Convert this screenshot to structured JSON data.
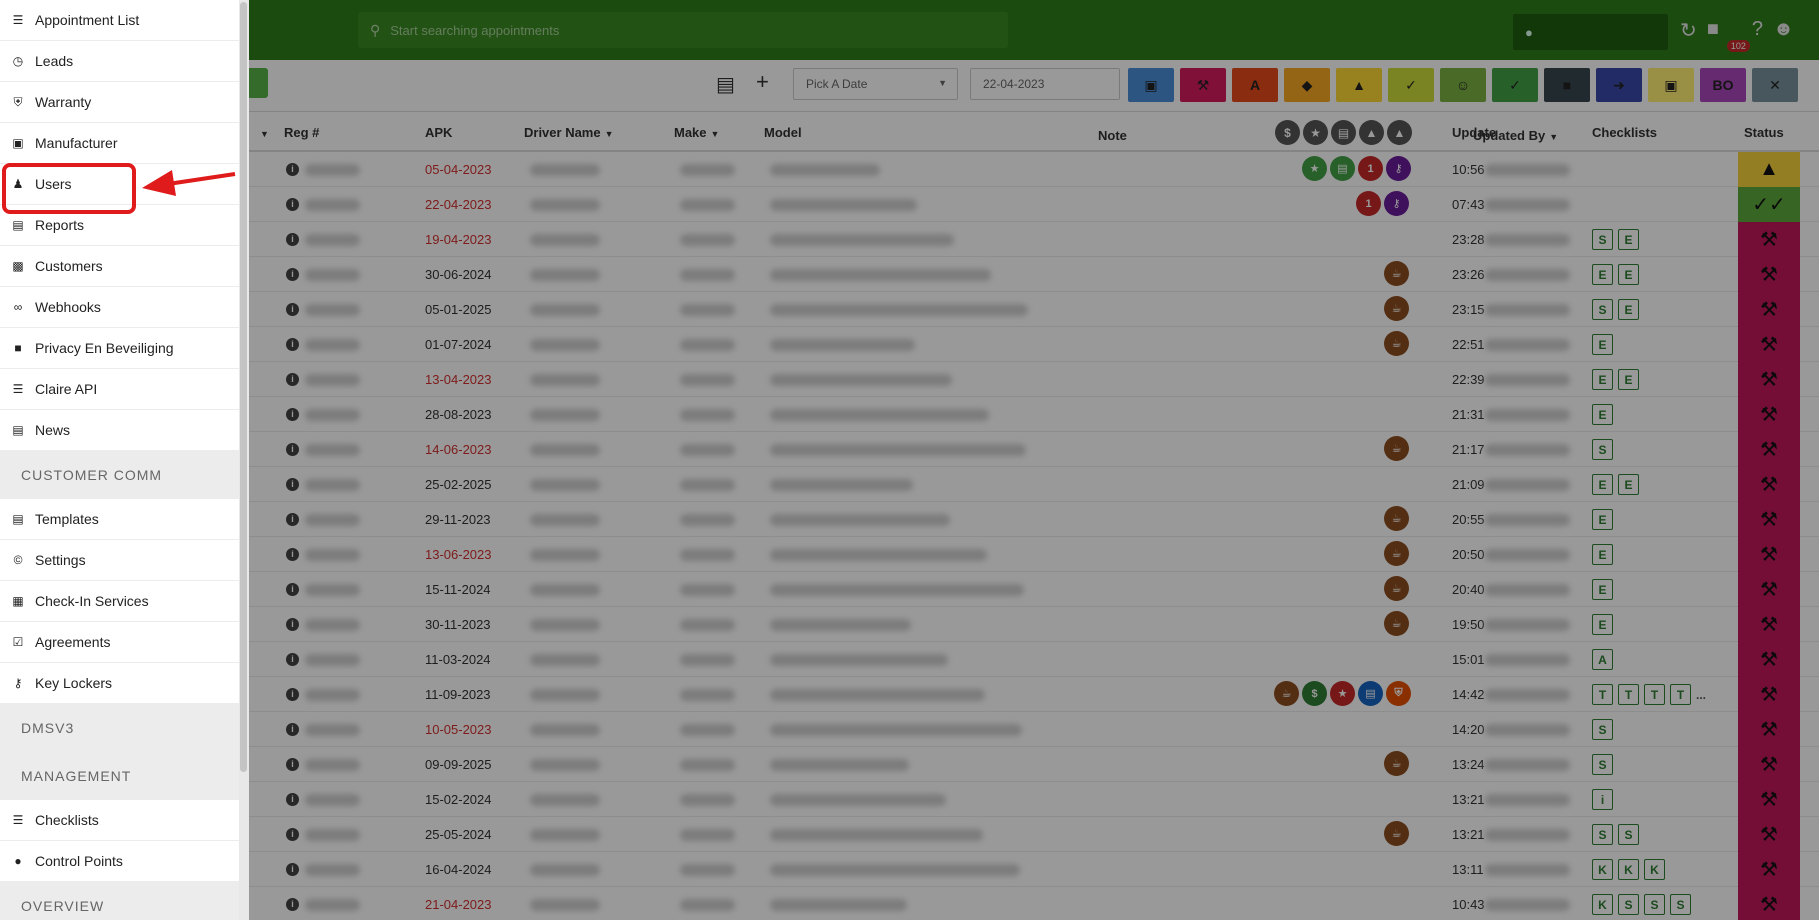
{
  "header": {
    "search_placeholder": "Start searching appointments",
    "notification_count": "102"
  },
  "toolbar": {
    "pick_date": "Pick A Date",
    "date_value": "22-04-2023",
    "bo_label": "BO"
  },
  "table": {
    "columns": [
      "Reg #",
      "APK",
      "Driver Name",
      "Make",
      "Model",
      "Note",
      "Update",
      "Updated By",
      "Checklists",
      "Status"
    ],
    "rows": [
      {
        "apk": "05-04-2023",
        "update": "10:56",
        "checklists": []
      },
      {
        "apk": "22-04-2023",
        "update": "07:43",
        "checklists": []
      },
      {
        "apk": "19-04-2023",
        "update": "23:28",
        "checklists": [
          "S",
          "E"
        ]
      },
      {
        "apk": "30-06-2024",
        "update": "23:26",
        "checklists": [
          "E",
          "E"
        ]
      },
      {
        "apk": "05-01-2025",
        "update": "23:15",
        "checklists": [
          "S",
          "E"
        ]
      },
      {
        "apk": "01-07-2024",
        "update": "22:51",
        "checklists": [
          "E"
        ]
      },
      {
        "apk": "13-04-2023",
        "update": "22:39",
        "checklists": [
          "E",
          "E"
        ]
      },
      {
        "apk": "28-08-2023",
        "update": "21:31",
        "checklists": [
          "E"
        ]
      },
      {
        "apk": "14-06-2023",
        "update": "21:17",
        "checklists": [
          "S"
        ]
      },
      {
        "apk": "25-02-2025",
        "update": "21:09",
        "checklists": [
          "E",
          "E"
        ]
      },
      {
        "apk": "29-11-2023",
        "update": "20:55",
        "checklists": [
          "E"
        ]
      },
      {
        "apk": "13-06-2023",
        "update": "20:50",
        "checklists": [
          "E"
        ]
      },
      {
        "apk": "15-11-2024",
        "update": "20:40",
        "checklists": [
          "E"
        ]
      },
      {
        "apk": "30-11-2023",
        "update": "19:50",
        "checklists": [
          "E"
        ]
      },
      {
        "apk": "11-03-2024",
        "update": "15:01",
        "checklists": [
          "A"
        ]
      },
      {
        "apk": "11-09-2023",
        "update": "14:42",
        "checklists": [
          "T",
          "T",
          "T",
          "T"
        ],
        "more": "..."
      },
      {
        "apk": "10-05-2023",
        "update": "14:20",
        "checklists": [
          "S"
        ]
      },
      {
        "apk": "09-09-2025",
        "update": "13:24",
        "checklists": [
          "S"
        ]
      },
      {
        "apk": "15-02-2024",
        "update": "13:21",
        "checklists": [
          "i"
        ]
      },
      {
        "apk": "25-05-2024",
        "update": "13:21",
        "checklists": [
          "S",
          "S"
        ]
      },
      {
        "apk": "16-04-2024",
        "update": "13:11",
        "checklists": [
          "K",
          "K",
          "K"
        ]
      },
      {
        "apk": "21-04-2023",
        "update": "10:43",
        "checklists": [
          "K",
          "S",
          "S",
          "S"
        ]
      }
    ]
  },
  "sidebar": {
    "items_top": [
      {
        "label": "Appointment List",
        "icon": "list-icon"
      },
      {
        "label": "Leads",
        "icon": "clock-icon"
      },
      {
        "label": "Warranty",
        "icon": "shield-icon"
      },
      {
        "label": "Manufacturer",
        "icon": "factory-icon"
      },
      {
        "label": "Users",
        "icon": "users-icon"
      },
      {
        "label": "Reports",
        "icon": "bar-chart-icon"
      },
      {
        "label": "Customers",
        "icon": "id-card-icon"
      },
      {
        "label": "Webhooks",
        "icon": "link-icon"
      },
      {
        "label": "Privacy En Beveiliging",
        "icon": "lock-icon"
      },
      {
        "label": "Claire API",
        "icon": "server-icon"
      },
      {
        "label": "News",
        "icon": "newspaper-icon"
      }
    ],
    "section_customer_comm": "CUSTOMER COMM",
    "items_comm": [
      {
        "label": "Templates",
        "icon": "film-icon"
      },
      {
        "label": "Settings",
        "icon": "copyright-icon"
      },
      {
        "label": "Check-In Services",
        "icon": "table-icon"
      },
      {
        "label": "Agreements",
        "icon": "checkbox-icon"
      },
      {
        "label": "Key Lockers",
        "icon": "key-icon"
      }
    ],
    "section_dmsv3": "DMSV3",
    "section_management": "MANAGEMENT",
    "items_management": [
      {
        "label": "Checklists",
        "icon": "list-icon"
      },
      {
        "label": "Control Points",
        "icon": "comment-icon"
      }
    ],
    "section_overview": "OVERVIEW"
  },
  "colors": {
    "header_green": "#2f7d1c",
    "highlight_red": "#e01b1b",
    "status_red": "#c2185b",
    "status_yellow": "#f5d33b",
    "status_green": "#5aa83c"
  }
}
